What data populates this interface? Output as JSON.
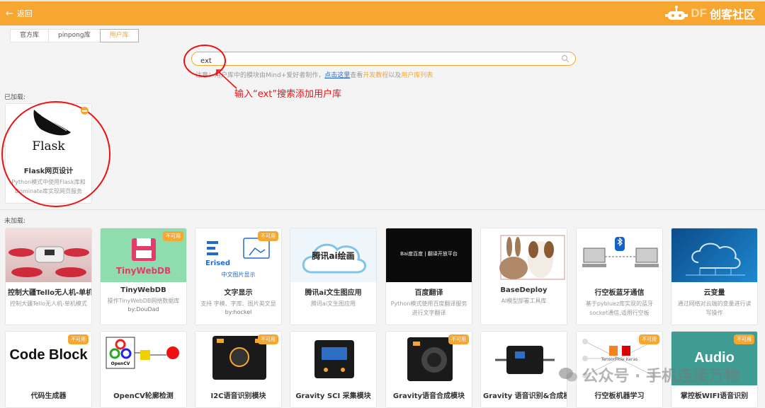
{
  "header": {
    "back_label": "返回",
    "brand_latin": "DF",
    "brand_cn": "创客社区"
  },
  "tabs": [
    {
      "label": "官方库",
      "active": false
    },
    {
      "label": "pinpong库",
      "active": false
    },
    {
      "label": "用户库",
      "active": true
    }
  ],
  "search": {
    "value": "ext",
    "placeholder": ""
  },
  "note": {
    "prefix": "注意：用户库中的模块由Mind+爱好者制作，",
    "link1": "点击这里",
    "mid1": "查看",
    "link2": "开发教程",
    "mid2": "以及",
    "link3": "用户库列表"
  },
  "annotation": {
    "text": "输入“ext”搜索添加用户库"
  },
  "loaded": {
    "label": "已加载:",
    "items": [
      {
        "title": "Flask网页设计",
        "desc": "Python模式中使用Flask库和Dominate库实现网页服务",
        "logo_text": "Flask"
      }
    ]
  },
  "unloaded": {
    "label": "未加载:",
    "row1": [
      {
        "title": "控制大疆Tello无人机-单机模式",
        "desc": "控制大疆Tello无人机-单机模式",
        "author": "",
        "badge": ""
      },
      {
        "title": "TinyWebDB",
        "desc": "操作TinyWebDB网络数据库",
        "author": "by:DouDad",
        "badge": "不可用",
        "thumb_text": "TinyWebDB"
      },
      {
        "title": "文字显示",
        "desc": "支持 字模、字库、图片英文显示",
        "author": "by:hockel",
        "badge": "不可用",
        "thumb_text": "Erised",
        "thumb_sub": "中文图片显示"
      },
      {
        "title": "腾讯ai文生图应用",
        "desc": "腾讯ai文生图应用",
        "author": "",
        "badge": "",
        "thumb_text": "腾讯ai绘画"
      },
      {
        "title": "百度翻译",
        "desc": "Python模式使用百度翻译服务进行文字翻译",
        "author": "",
        "badge": "",
        "thumb_text": "Bai度百度 | 翻译开放平台"
      },
      {
        "title": "BaseDeploy",
        "desc": "AI模型部署工具库",
        "author": "",
        "badge": ""
      },
      {
        "title": "行空板蓝牙通信",
        "desc": "基于pybluez库实现的蓝牙socket通信,适用行空板",
        "author": "",
        "badge": ""
      },
      {
        "title": "云变量",
        "desc": "通过网络对云端的变量进行读写操作",
        "author": "",
        "badge": ""
      }
    ],
    "row2": [
      {
        "title": "代码生成器",
        "badge": "不可用",
        "thumb_text": "Code Block"
      },
      {
        "title": "OpenCV轮廓检测",
        "badge": "",
        "thumb_text": "OpenCV"
      },
      {
        "title": "I2C语音识别模块",
        "badge": "不可用"
      },
      {
        "title": "Gravity SCI 采集模块",
        "badge": ""
      },
      {
        "title": "Gravity语音合成模块",
        "badge": "不可用"
      },
      {
        "title": "Gravity 语音识别&合成模块",
        "badge": ""
      },
      {
        "title": "行空板机器学习",
        "badge": "不可用",
        "thumb_text": "TensorFlow Keras"
      },
      {
        "title": "掌控板WIFI语音识别",
        "badge": "不可用",
        "thumb_text": "Audio"
      }
    ]
  },
  "watermark": {
    "text": "公众号 · 手机连接万物"
  },
  "colors": {
    "accent": "#f7a730",
    "annotation": "#e11111",
    "link": "#2a6ad6"
  }
}
